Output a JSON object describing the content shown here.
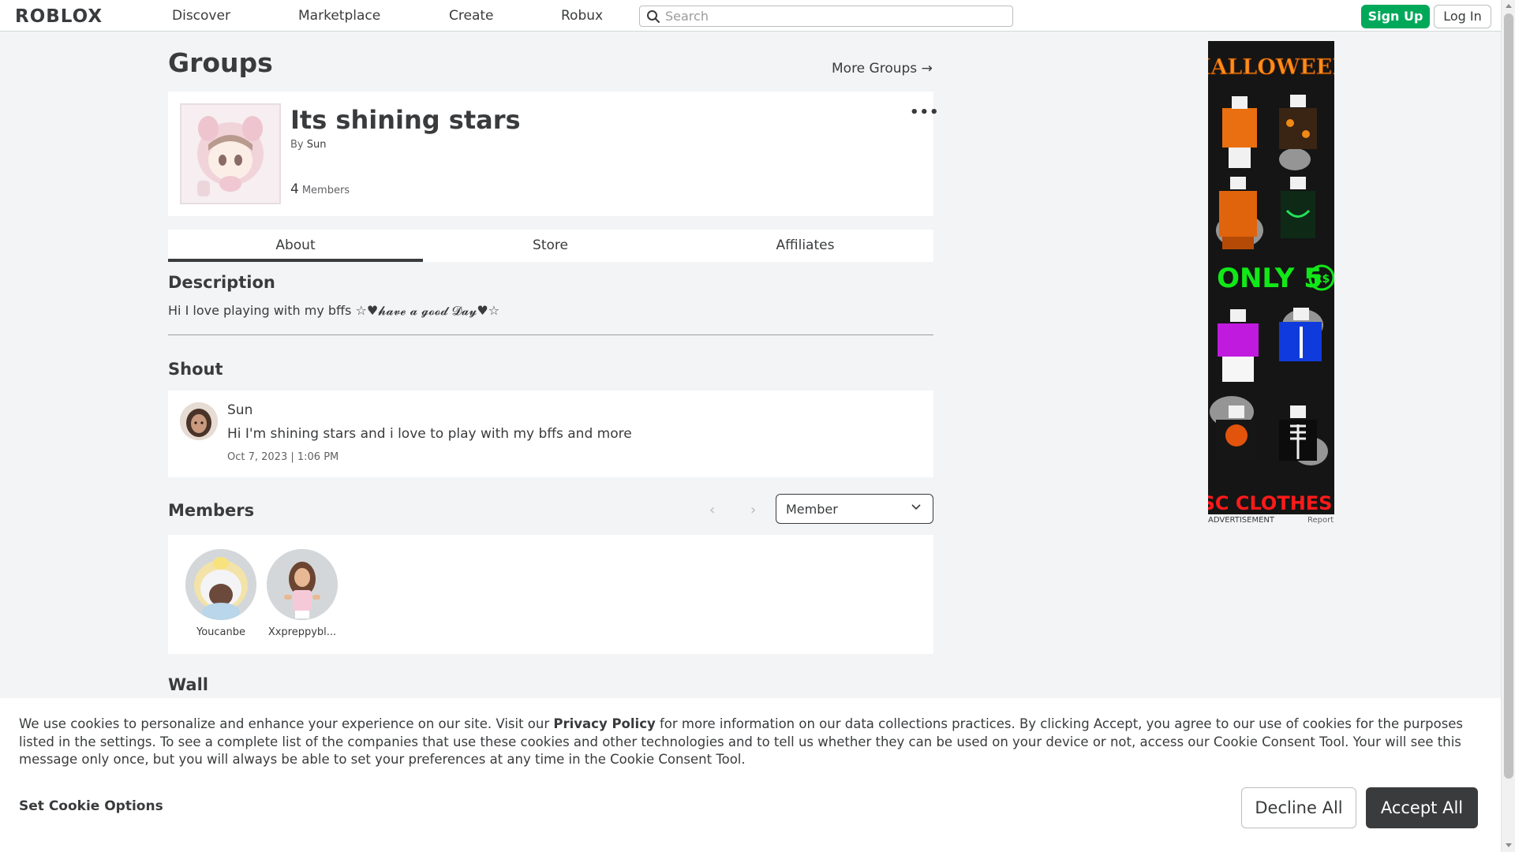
{
  "nav": {
    "logo": "ROBLOX",
    "links": [
      "Discover",
      "Marketplace",
      "Create",
      "Robux"
    ],
    "search_placeholder": "Search",
    "signup": "Sign Up",
    "login": "Log In"
  },
  "page": {
    "title": "Groups",
    "more_groups": "More Groups →"
  },
  "group": {
    "name": "Its shining stars",
    "by_label": "By",
    "owner": "Sun",
    "member_count": "4",
    "members_label": "Members",
    "more_icon": "more-options-icon"
  },
  "tabs": [
    "About",
    "Store",
    "Affiliates"
  ],
  "active_tab": "About",
  "description": {
    "title": "Description",
    "text": "Hi I love playing with my bffs ☆♥𝓱𝓪𝓿𝓮 𝓪 𝓰𝓸𝓸𝓭 𝓓𝓪𝔂♥☆"
  },
  "shout": {
    "title": "Shout",
    "user": "Sun",
    "body": "Hi I'm shining stars and i love to play with my bffs and more",
    "date": "Oct 7, 2023 | 1:06 PM"
  },
  "members": {
    "title": "Members",
    "role_selected": "Member",
    "list": [
      {
        "name": "Youcanbe"
      },
      {
        "name": "Xxpreppybl..."
      }
    ]
  },
  "wall": {
    "title": "Wall"
  },
  "ad": {
    "headline": "HALLOWEEN",
    "price_text": "ONLY 5",
    "footer_text": "SC CLOTHES!",
    "label": "ADVERTISEMENT",
    "report": "Report"
  },
  "cookie": {
    "text_before": "We use cookies to personalize and enhance your experience on our site. Visit our ",
    "link": "Privacy Policy",
    "text_after": " for more information on our data collections practices. By clicking Accept, you agree to our use of cookies for the purposes listed in the settings. To see a complete list of the companies that use these cookies and other technologies and to tell us whether they can be used on your device or not, access our Cookie Consent Tool. Your will see this message only once, but you will always be able to set your preferences at any time in the Cookie Consent Tool.",
    "options": "Set Cookie Options",
    "decline": "Decline All",
    "accept": "Accept All"
  },
  "colors": {
    "signup_green": "#00a85a",
    "text_dark": "#393b3d",
    "page_bg": "#f2f4f5"
  }
}
